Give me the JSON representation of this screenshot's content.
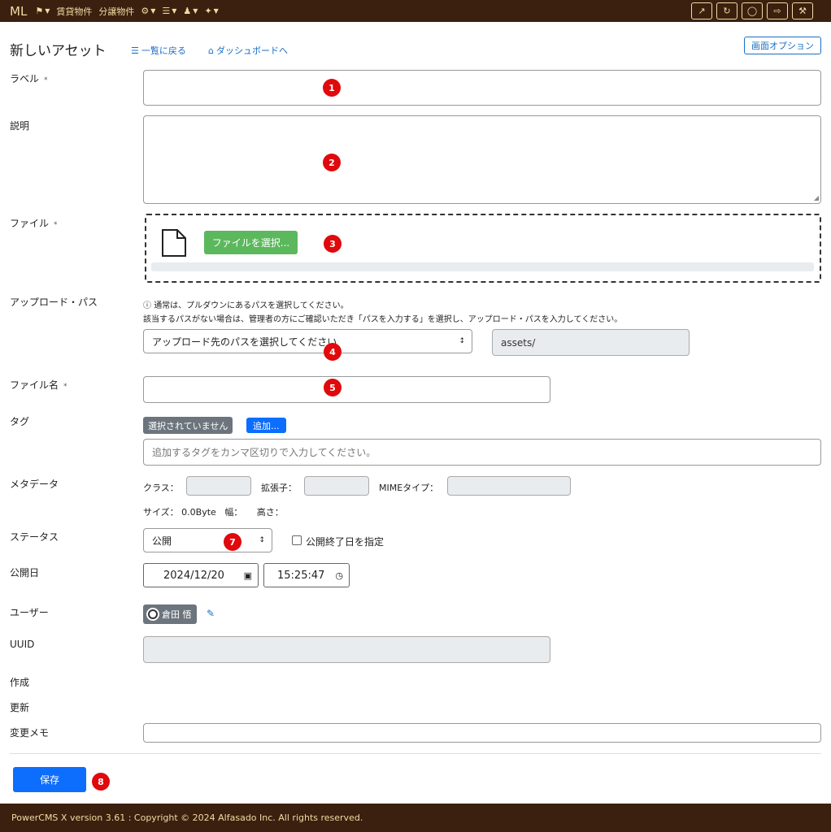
{
  "topbar": {
    "brand": "ML",
    "menu_items": [
      {
        "label": "",
        "icon": "bookmark-icon"
      },
      {
        "label": "賃貸物件",
        "icon": ""
      },
      {
        "label": "分譲物件",
        "icon": ""
      },
      {
        "label": "",
        "icon": "gear-icon"
      },
      {
        "label": "",
        "icon": "database-icon"
      },
      {
        "label": "",
        "icon": "user-plus-icon"
      },
      {
        "label": "",
        "icon": "plug-icon"
      }
    ],
    "right_buttons": [
      "external-link-icon",
      "refresh-icon",
      "user-circle-icon",
      "sign-out-icon",
      "wrench-icon"
    ]
  },
  "header": {
    "title": "新しいアセット",
    "back_link": "一覧に戻る",
    "dashboard_link": "ダッシュボードへ",
    "screen_options": "画面オプション"
  },
  "form": {
    "label_field": {
      "label": "ラベル",
      "required": "*",
      "value": ""
    },
    "description_field": {
      "label": "説明",
      "value": ""
    },
    "file_field": {
      "label": "ファイル",
      "required": "*",
      "button": "ファイルを選択..."
    },
    "upload_path": {
      "label": "アップロード・パス",
      "help_line1": "通常は、プルダウンにあるパスを選択してください。",
      "help_line2": "該当するパスがない場合は、管理者の方にご確認いただき「パスを入力する」を選択し、アップロード・パスを入力してください。",
      "select_value": "アップロード先のパスを選択してください",
      "path_value": "assets/"
    },
    "filename_field": {
      "label": "ファイル名",
      "required": "*",
      "value": ""
    },
    "tags": {
      "label": "タグ",
      "none_badge": "選択されていません",
      "add_button": "追加...",
      "placeholder": "追加するタグをカンマ区切りで入力してください。"
    },
    "metadata": {
      "label": "メタデータ",
      "class_label": "クラス：",
      "ext_label": "拡張子：",
      "mime_label": "MIMEタイプ：",
      "size_label": "サイズ：",
      "size_value": "0.0Byte",
      "width_label": "幅：",
      "height_label": "高さ："
    },
    "status": {
      "label": "ステータス",
      "value": "公開",
      "end_date_label": "公開終了日を指定"
    },
    "publish_date": {
      "label": "公開日",
      "date": "2024/12/20",
      "time": "15:25:47"
    },
    "user": {
      "label": "ユーザー",
      "name": "倉田 悟"
    },
    "uuid": {
      "label": "UUID",
      "value": ""
    },
    "created": {
      "label": "作成"
    },
    "modified": {
      "label": "更新"
    },
    "change_note": {
      "label": "変更メモ",
      "value": ""
    }
  },
  "markers": [
    "1",
    "2",
    "3",
    "4",
    "5",
    "7",
    "8"
  ],
  "save_button": "保存",
  "footer": "PowerCMS X version 3.61 : Copyright © 2024 Alfasado Inc. All rights reserved.",
  "colors": {
    "topbar": "#3b200f",
    "accent": "#0d6efd",
    "file_button": "#5cb85c",
    "marker": "#e0090c"
  }
}
